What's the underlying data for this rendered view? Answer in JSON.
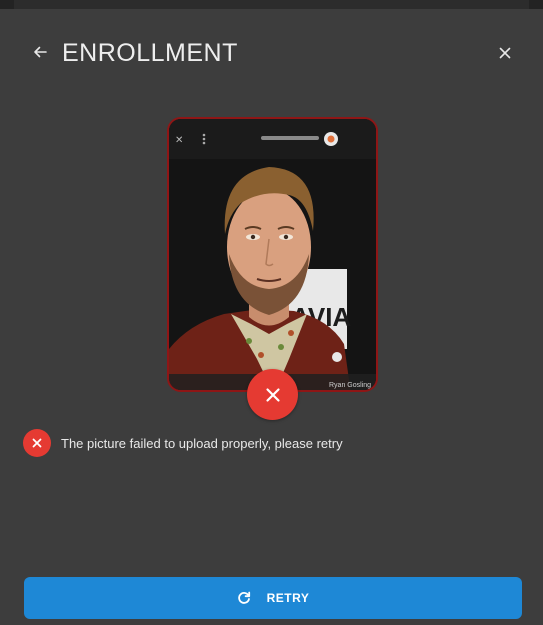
{
  "header": {
    "title": "ENROLLMENT",
    "back_icon": "arrow-left-icon",
    "close_icon": "close-icon"
  },
  "photo": {
    "overlay_label": "Ryan Gosling",
    "sign_text": "AVIA",
    "status_icon": "close-icon",
    "status_color": "#e53a32"
  },
  "error": {
    "icon": "close-icon",
    "message": "The picture failed to upload properly, please retry"
  },
  "retry_button": {
    "label": "RETRY",
    "icon": "refresh-icon",
    "color": "#1e88d6"
  }
}
